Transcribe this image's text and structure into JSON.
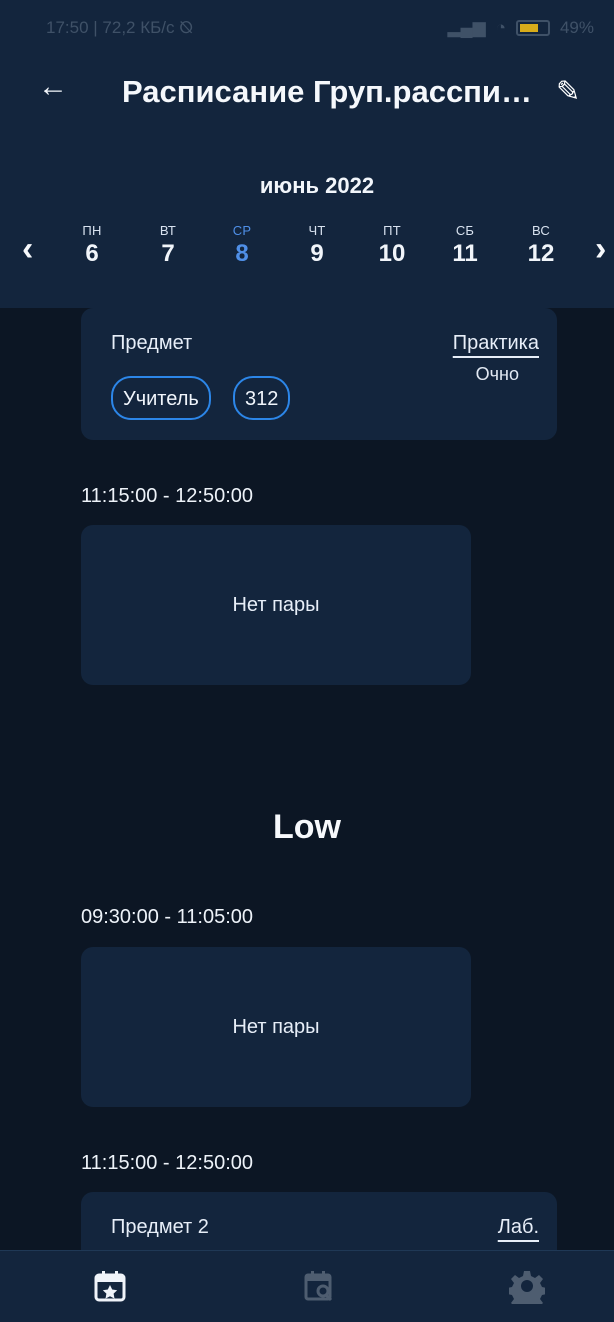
{
  "status": {
    "left": "17:50 | 72,2 КБ/с ⦰",
    "right": "49%"
  },
  "header": {
    "title": "Расписание Груп.расспи…",
    "month": "июнь 2022",
    "days": [
      {
        "weekday": "ПН",
        "number": "6"
      },
      {
        "weekday": "ВТ",
        "number": "7"
      },
      {
        "weekday": "СР",
        "number": "8"
      },
      {
        "weekday": "ЧТ",
        "number": "9"
      },
      {
        "weekday": "ПТ",
        "number": "10"
      },
      {
        "weekday": "СБ",
        "number": "11"
      },
      {
        "weekday": "ВС",
        "number": "12"
      }
    ]
  },
  "schedule": {
    "topCard": {
      "subject": "Предмет",
      "type": "Практика",
      "format": "Очно",
      "teacher": "Учитель",
      "room": "312"
    },
    "firstTime": "11:15:00 - 12:50:00",
    "firstEmpty": "Нет пары",
    "group": "Low",
    "secondTime": "09:30:00 - 11:05:00",
    "secondEmpty": "Нет пары",
    "thirdTime": "11:15:00 - 12:50:00",
    "bottomCard": {
      "subject": "Предмет 2",
      "type": "Лаб."
    }
  },
  "icons": {
    "back": "arrow-left",
    "edit": "pencil",
    "prev": "chevron-left",
    "next": "chevron-right",
    "schedule": "calendar-star",
    "search": "calendar-search",
    "settings": "gear"
  }
}
